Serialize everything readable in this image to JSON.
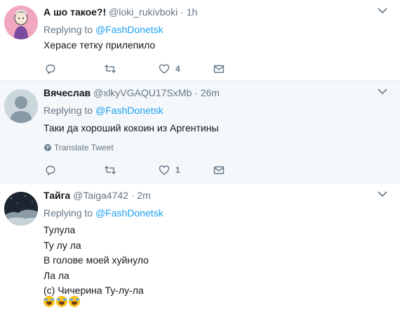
{
  "tweets": [
    {
      "fullname": "А шо такое?!",
      "username": "@loki_rukivboki",
      "dot": "·",
      "time": "1h",
      "replying_prefix": "Replying to",
      "replying_to": "@FashDonetsk",
      "text": "Херасе тетку прилепило",
      "likes": "4",
      "avatar_icon": "cartoon-avatar",
      "avatar_bg": "#f1a7c0"
    },
    {
      "fullname": "Вячеслав",
      "username": "@xlkyVGAQU17SxMb",
      "dot": "·",
      "time": "26m",
      "replying_prefix": "Replying to",
      "replying_to": "@FashDonetsk",
      "text": "Таки да хороший кокоин из Аргентины",
      "translate": "Translate Tweet",
      "likes": "1",
      "avatar_icon": "default-avatar",
      "avatar_bg": "#ccd6dd"
    },
    {
      "fullname": "Тайга",
      "username": "@Taiga4742",
      "dot": "·",
      "time": "2m",
      "replying_prefix": "Replying to",
      "replying_to": "@FashDonetsk",
      "text": "Тулула\nТу лу ла\nВ голове моей хуйнуло\nЛа ла\n(c) Чичерина Ту-лу-ла",
      "emoji_icon": "face-with-tears-of-joy",
      "avatar_icon": "night-sky-avatar",
      "avatar_bg": "#1d2530"
    }
  ],
  "colors": {
    "link": "#1da1f2",
    "secondary": "#657786",
    "hover_bg": "#f5f8fa"
  }
}
